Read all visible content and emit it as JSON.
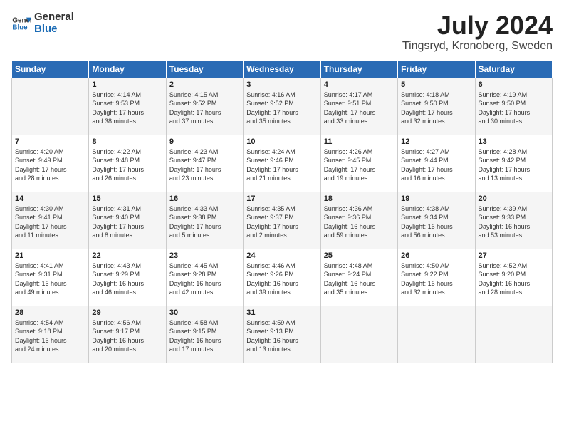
{
  "header": {
    "logo_general": "General",
    "logo_blue": "Blue",
    "month_year": "July 2024",
    "location": "Tingsryd, Kronoberg, Sweden"
  },
  "days_of_week": [
    "Sunday",
    "Monday",
    "Tuesday",
    "Wednesday",
    "Thursday",
    "Friday",
    "Saturday"
  ],
  "weeks": [
    [
      {
        "day": "",
        "content": ""
      },
      {
        "day": "1",
        "content": "Sunrise: 4:14 AM\nSunset: 9:53 PM\nDaylight: 17 hours\nand 38 minutes."
      },
      {
        "day": "2",
        "content": "Sunrise: 4:15 AM\nSunset: 9:52 PM\nDaylight: 17 hours\nand 37 minutes."
      },
      {
        "day": "3",
        "content": "Sunrise: 4:16 AM\nSunset: 9:52 PM\nDaylight: 17 hours\nand 35 minutes."
      },
      {
        "day": "4",
        "content": "Sunrise: 4:17 AM\nSunset: 9:51 PM\nDaylight: 17 hours\nand 33 minutes."
      },
      {
        "day": "5",
        "content": "Sunrise: 4:18 AM\nSunset: 9:50 PM\nDaylight: 17 hours\nand 32 minutes."
      },
      {
        "day": "6",
        "content": "Sunrise: 4:19 AM\nSunset: 9:50 PM\nDaylight: 17 hours\nand 30 minutes."
      }
    ],
    [
      {
        "day": "7",
        "content": "Sunrise: 4:20 AM\nSunset: 9:49 PM\nDaylight: 17 hours\nand 28 minutes."
      },
      {
        "day": "8",
        "content": "Sunrise: 4:22 AM\nSunset: 9:48 PM\nDaylight: 17 hours\nand 26 minutes."
      },
      {
        "day": "9",
        "content": "Sunrise: 4:23 AM\nSunset: 9:47 PM\nDaylight: 17 hours\nand 23 minutes."
      },
      {
        "day": "10",
        "content": "Sunrise: 4:24 AM\nSunset: 9:46 PM\nDaylight: 17 hours\nand 21 minutes."
      },
      {
        "day": "11",
        "content": "Sunrise: 4:26 AM\nSunset: 9:45 PM\nDaylight: 17 hours\nand 19 minutes."
      },
      {
        "day": "12",
        "content": "Sunrise: 4:27 AM\nSunset: 9:44 PM\nDaylight: 17 hours\nand 16 minutes."
      },
      {
        "day": "13",
        "content": "Sunrise: 4:28 AM\nSunset: 9:42 PM\nDaylight: 17 hours\nand 13 minutes."
      }
    ],
    [
      {
        "day": "14",
        "content": "Sunrise: 4:30 AM\nSunset: 9:41 PM\nDaylight: 17 hours\nand 11 minutes."
      },
      {
        "day": "15",
        "content": "Sunrise: 4:31 AM\nSunset: 9:40 PM\nDaylight: 17 hours\nand 8 minutes."
      },
      {
        "day": "16",
        "content": "Sunrise: 4:33 AM\nSunset: 9:38 PM\nDaylight: 17 hours\nand 5 minutes."
      },
      {
        "day": "17",
        "content": "Sunrise: 4:35 AM\nSunset: 9:37 PM\nDaylight: 17 hours\nand 2 minutes."
      },
      {
        "day": "18",
        "content": "Sunrise: 4:36 AM\nSunset: 9:36 PM\nDaylight: 16 hours\nand 59 minutes."
      },
      {
        "day": "19",
        "content": "Sunrise: 4:38 AM\nSunset: 9:34 PM\nDaylight: 16 hours\nand 56 minutes."
      },
      {
        "day": "20",
        "content": "Sunrise: 4:39 AM\nSunset: 9:33 PM\nDaylight: 16 hours\nand 53 minutes."
      }
    ],
    [
      {
        "day": "21",
        "content": "Sunrise: 4:41 AM\nSunset: 9:31 PM\nDaylight: 16 hours\nand 49 minutes."
      },
      {
        "day": "22",
        "content": "Sunrise: 4:43 AM\nSunset: 9:29 PM\nDaylight: 16 hours\nand 46 minutes."
      },
      {
        "day": "23",
        "content": "Sunrise: 4:45 AM\nSunset: 9:28 PM\nDaylight: 16 hours\nand 42 minutes."
      },
      {
        "day": "24",
        "content": "Sunrise: 4:46 AM\nSunset: 9:26 PM\nDaylight: 16 hours\nand 39 minutes."
      },
      {
        "day": "25",
        "content": "Sunrise: 4:48 AM\nSunset: 9:24 PM\nDaylight: 16 hours\nand 35 minutes."
      },
      {
        "day": "26",
        "content": "Sunrise: 4:50 AM\nSunset: 9:22 PM\nDaylight: 16 hours\nand 32 minutes."
      },
      {
        "day": "27",
        "content": "Sunrise: 4:52 AM\nSunset: 9:20 PM\nDaylight: 16 hours\nand 28 minutes."
      }
    ],
    [
      {
        "day": "28",
        "content": "Sunrise: 4:54 AM\nSunset: 9:18 PM\nDaylight: 16 hours\nand 24 minutes."
      },
      {
        "day": "29",
        "content": "Sunrise: 4:56 AM\nSunset: 9:17 PM\nDaylight: 16 hours\nand 20 minutes."
      },
      {
        "day": "30",
        "content": "Sunrise: 4:58 AM\nSunset: 9:15 PM\nDaylight: 16 hours\nand 17 minutes."
      },
      {
        "day": "31",
        "content": "Sunrise: 4:59 AM\nSunset: 9:13 PM\nDaylight: 16 hours\nand 13 minutes."
      },
      {
        "day": "",
        "content": ""
      },
      {
        "day": "",
        "content": ""
      },
      {
        "day": "",
        "content": ""
      }
    ]
  ]
}
